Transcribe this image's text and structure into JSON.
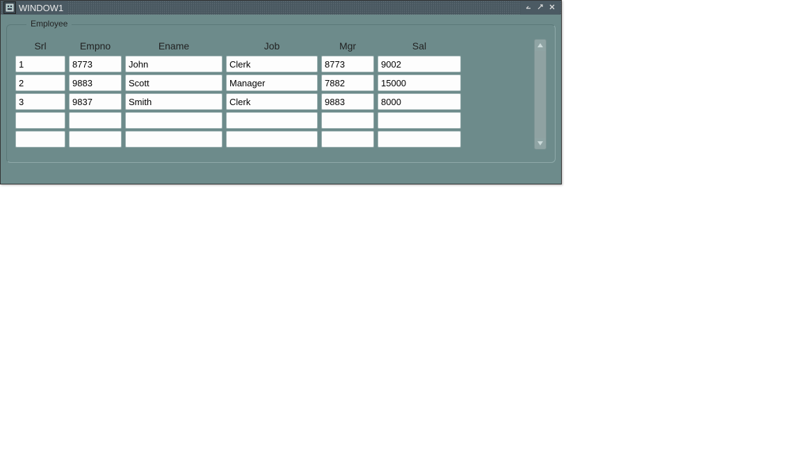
{
  "window": {
    "title": "WINDOW1"
  },
  "fieldset": {
    "legend": "Employee"
  },
  "columns": {
    "srl": "Srl",
    "empno": "Empno",
    "ename": "Ename",
    "job": "Job",
    "mgr": "Mgr",
    "sal": "Sal"
  },
  "rows": [
    {
      "srl": "1",
      "empno": "8773",
      "ename": "John",
      "job": "Clerk",
      "mgr": "8773",
      "sal": "9002"
    },
    {
      "srl": "2",
      "empno": "9883",
      "ename": "Scott",
      "job": "Manager",
      "mgr": "7882",
      "sal": "15000"
    },
    {
      "srl": "3",
      "empno": "9837",
      "ename": "Smith",
      "job": "Clerk",
      "mgr": "9883",
      "sal": "8000"
    },
    {
      "srl": "",
      "empno": "",
      "ename": "",
      "job": "",
      "mgr": "",
      "sal": ""
    },
    {
      "srl": "",
      "empno": "",
      "ename": "",
      "job": "",
      "mgr": "",
      "sal": ""
    }
  ]
}
